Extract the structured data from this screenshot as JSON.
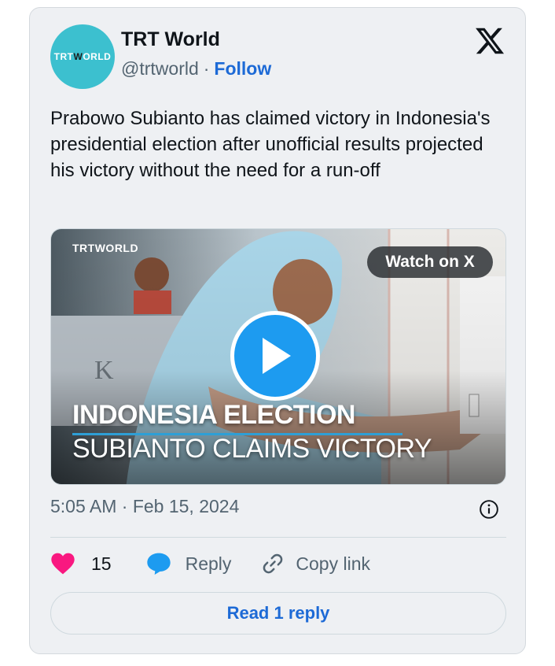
{
  "author": {
    "name": "TRT World",
    "handle": "@trtworld",
    "separator": "·",
    "follow_label": "Follow",
    "avatar_logo": "TRT WORLD",
    "avatar_color": "#3cc0cf"
  },
  "platform_icon": "x-logo-icon",
  "tweet": {
    "text": "Prabowo Subianto has claimed victory in Indonesia's presidential election after unofficial results projected his victory without the need for a run-off"
  },
  "media": {
    "brand": "TRTWORLD",
    "watch_label": "Watch on X",
    "headline_line1": "INDONESIA ELECTION",
    "headline_line2": "SUBIANTO CLAIMS VICTORY",
    "play_icon": "play-icon",
    "play_color": "#1d9bf0"
  },
  "timestamp": "5:05 AM · Feb 15, 2024",
  "actions": {
    "like_count": "15",
    "reply_label": "Reply",
    "copy_label": "Copy link",
    "like_color": "#f91880",
    "reply_color": "#1d9bf0"
  },
  "read_reply_label": "Read 1 reply",
  "accent_color": "#1d6ad6"
}
